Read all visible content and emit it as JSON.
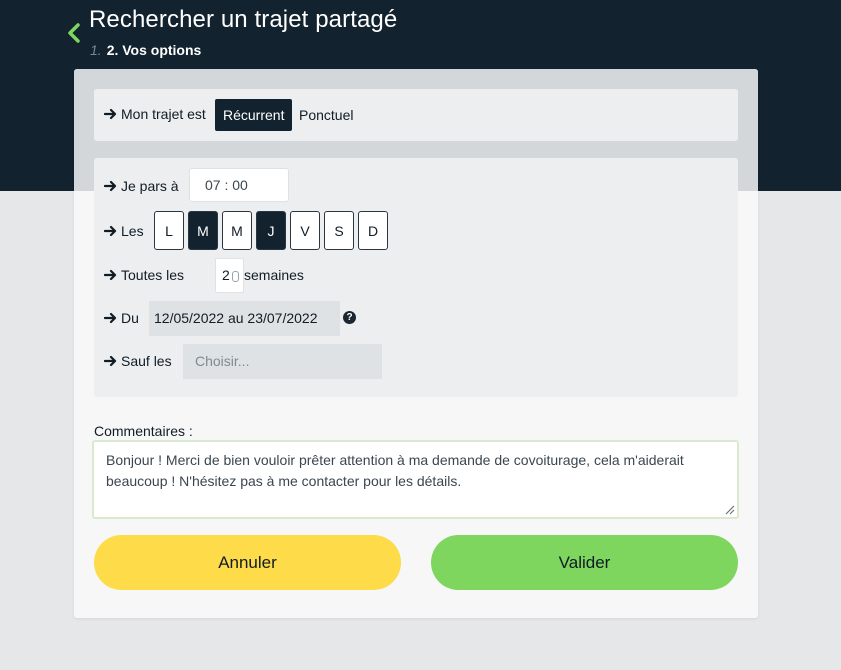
{
  "header": {
    "title": "Rechercher un trajet partagé",
    "step_prev": "1.",
    "step_current": "2. Vos options",
    "back_icon": "chevron-left-icon",
    "colors": {
      "band": "#12222e",
      "accent": "#7ed65e"
    }
  },
  "trip_type": {
    "label": "Mon trajet est",
    "options": [
      "Récurrent",
      "Ponctuel"
    ],
    "selected": "Récurrent"
  },
  "options": {
    "departure_label": "Je pars à",
    "departure_time": "07 : 00",
    "days_label": "Les",
    "days": [
      {
        "label": "L",
        "selected": false
      },
      {
        "label": "M",
        "selected": true
      },
      {
        "label": "M",
        "selected": false
      },
      {
        "label": "J",
        "selected": true
      },
      {
        "label": "V",
        "selected": false
      },
      {
        "label": "S",
        "selected": false
      },
      {
        "label": "D",
        "selected": false
      }
    ],
    "frequency_label": "Toutes les",
    "frequency_value": "2",
    "frequency_suffix": "semaines",
    "period_label": "Du",
    "period_value": "12/05/2022 au 23/07/2022",
    "period_help_icon": "question-circle-icon",
    "except_label": "Sauf les",
    "except_placeholder": "Choisir..."
  },
  "comments": {
    "label": "Commentaires :",
    "value": "Bonjour ! Merci de bien vouloir prêter attention à ma demande de covoiturage, cela m'aiderait beaucoup ! N'hésitez pas à me contacter pour les détails."
  },
  "actions": {
    "cancel_label": "Annuler",
    "validate_label": "Valider",
    "cancel_color": "#fddb49",
    "validate_color": "#7ed65e"
  }
}
